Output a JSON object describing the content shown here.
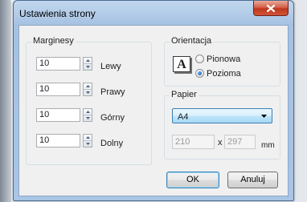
{
  "window": {
    "title": "Ustawienia strony"
  },
  "margins": {
    "group_label": "Marginesy",
    "rows": [
      {
        "value": "10",
        "label": "Lewy"
      },
      {
        "value": "10",
        "label": "Prawy"
      },
      {
        "value": "10",
        "label": "Górny"
      },
      {
        "value": "10",
        "label": "Dolny"
      }
    ]
  },
  "orientation": {
    "group_label": "Orientacja",
    "icon_letter": "A",
    "portrait_label": "Pionowa",
    "landscape_label": "Pozioma",
    "selected": "landscape"
  },
  "paper": {
    "group_label": "Papier",
    "selected_size": "A4",
    "width": "210",
    "times": "x",
    "height": "297",
    "unit": "mm"
  },
  "buttons": {
    "ok": "OK",
    "cancel": "Anuluj"
  },
  "icons": {
    "close": "close-icon",
    "dropdown": "chevron-down-icon",
    "spin_up": "arrow-up-icon",
    "spin_down": "arrow-down-icon"
  }
}
